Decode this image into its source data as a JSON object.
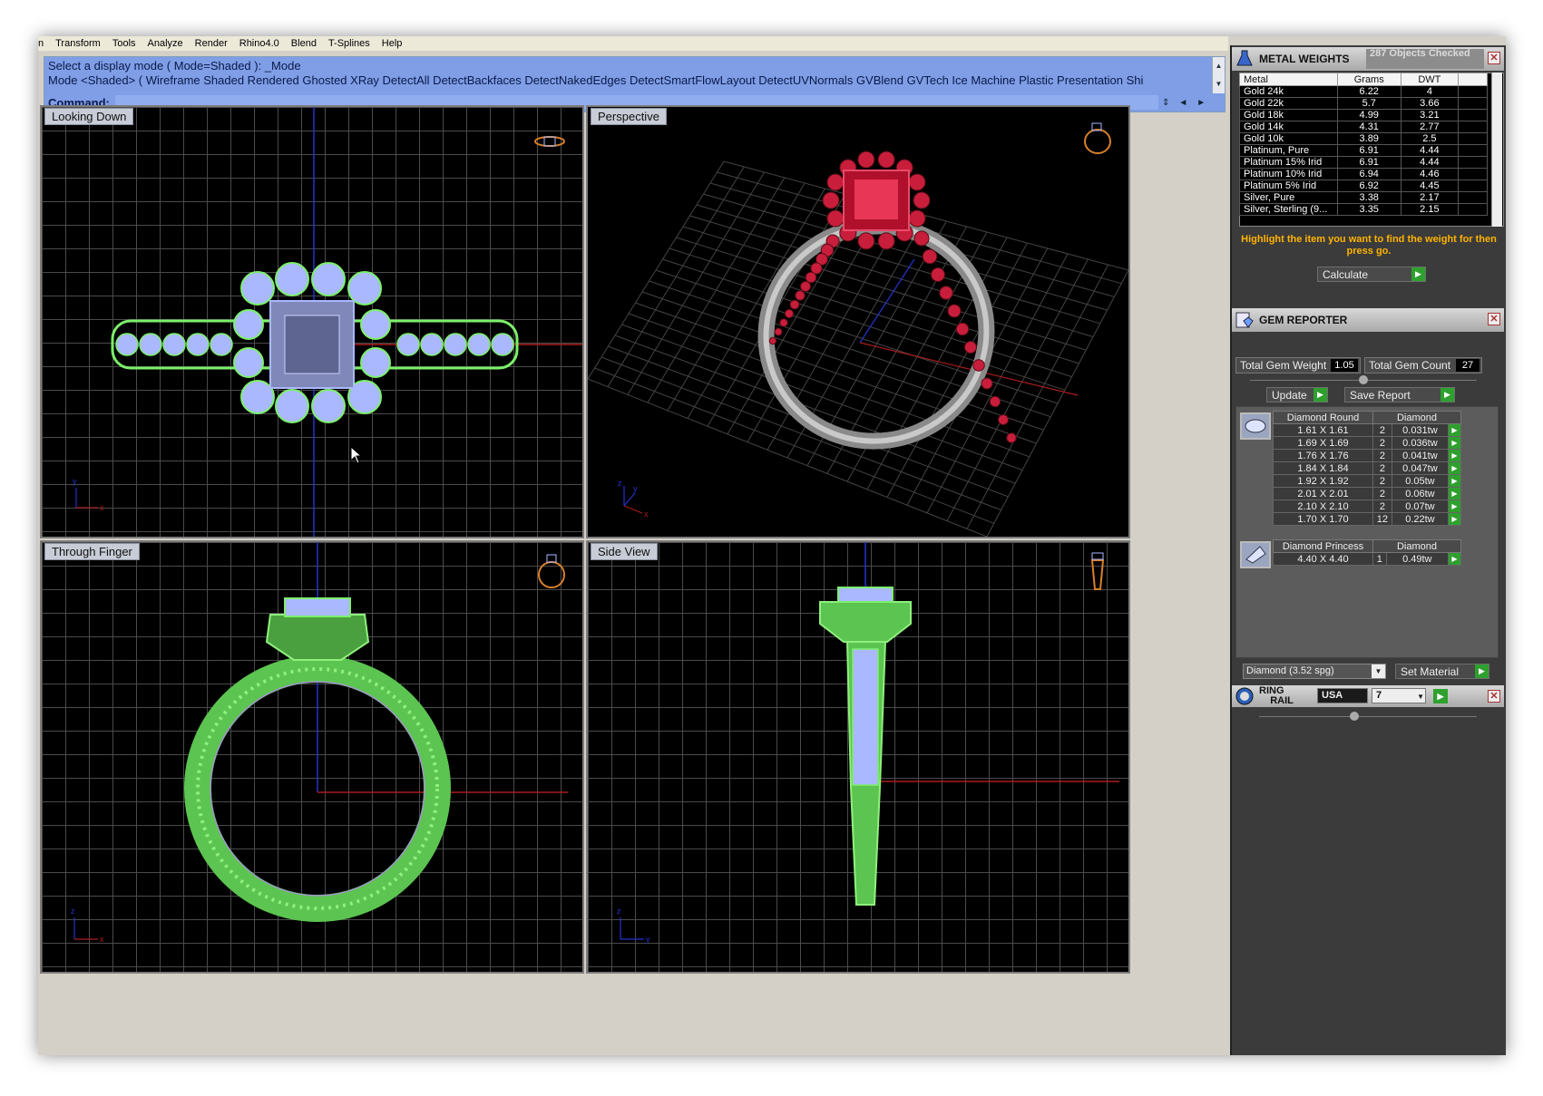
{
  "menu": [
    "n",
    "Transform",
    "Tools",
    "Analyze",
    "Render",
    "Rhino4.0",
    "Blend",
    "T-Splines",
    "Help"
  ],
  "command": {
    "history_line1": "Select a display mode ( Mode=Shaded ): _Mode",
    "history_line2": "Mode <Shaded> ( Wireframe  Shaded  Rendered  Ghosted  XRay  DetectAll  DetectBackfaces  DetectNakedEdges  DetectSmartFlowLayout  DetectUVNormals  GVBlend  GVTech  Ice  Machine  Plastic  Presentation  Shi",
    "prompt_label": "Command:",
    "value": ""
  },
  "viewports": {
    "top_left": "Looking Down",
    "top_right": "Perspective",
    "bottom_left": "Through Finger",
    "bottom_right": "Side View"
  },
  "axes": {
    "looking_down": [
      "y",
      "x"
    ],
    "perspective": [
      "z",
      "y",
      "x"
    ],
    "through_finger": [
      "z",
      "x"
    ],
    "side_view": [
      "z",
      "y"
    ]
  },
  "metal_weights": {
    "title": "METAL WEIGHTS",
    "objects_checked": "287 Objects Checked",
    "columns": [
      "Metal",
      "Grams",
      "DWT"
    ],
    "rows": [
      [
        "Gold 24k",
        "6.22",
        "4"
      ],
      [
        "Gold 22k",
        "5.7",
        "3.66"
      ],
      [
        "Gold 18k",
        "4.99",
        "3.21"
      ],
      [
        "Gold 14k",
        "4.31",
        "2.77"
      ],
      [
        "Gold 10k",
        "3.89",
        "2.5"
      ],
      [
        "Platinum, Pure",
        "6.91",
        "4.44"
      ],
      [
        "Platinum 15% Irid",
        "6.91",
        "4.44"
      ],
      [
        "Platinum 10% Irid",
        "6.94",
        "4.46"
      ],
      [
        "Platinum 5% Irid",
        "6.92",
        "4.45"
      ],
      [
        "Silver, Pure",
        "3.38",
        "2.17"
      ],
      [
        "Silver, Sterling (9...",
        "3.35",
        "2.15"
      ]
    ],
    "hint": "Highlight the item you want to find the weight for then press go.",
    "calculate_label": "Calculate"
  },
  "gem_reporter": {
    "title": "GEM REPORTER",
    "total_weight_label": "Total Gem Weight",
    "total_weight": "1.05",
    "total_count_label": "Total Gem Count",
    "total_count": "27",
    "update_label": "Update",
    "save_label": "Save Report",
    "round": {
      "header": [
        "Diamond Round",
        "Diamond"
      ],
      "rows": [
        [
          "1.61 X 1.61",
          "2",
          "0.031tw"
        ],
        [
          "1.69 X 1.69",
          "2",
          "0.036tw"
        ],
        [
          "1.76 X 1.76",
          "2",
          "0.041tw"
        ],
        [
          "1.84 X 1.84",
          "2",
          "0.047tw"
        ],
        [
          "1.92 X 1.92",
          "2",
          "0.05tw"
        ],
        [
          "2.01 X 2.01",
          "2",
          "0.06tw"
        ],
        [
          "2.10 X 2.10",
          "2",
          "0.07tw"
        ],
        [
          "1.70 X 1.70",
          "12",
          "0.22tw"
        ]
      ]
    },
    "princess": {
      "header": [
        "Diamond Princess",
        "Diamond"
      ],
      "rows": [
        [
          "4.40 X 4.40",
          "1",
          "0.49tw"
        ]
      ]
    },
    "material_value": "Diamond    (3.52 spg)",
    "set_material_label": "Set Material"
  },
  "ring_rail": {
    "title_line1": "RING",
    "title_line2": "RAIL",
    "region": "USA",
    "size": "7"
  },
  "colors": {
    "wire_green": "#7cf06a",
    "wire_blue": "#aab8ff",
    "ruby": "#c81e3c",
    "accent_go": "#2ea02e",
    "hint_orange": "#ffb300"
  }
}
